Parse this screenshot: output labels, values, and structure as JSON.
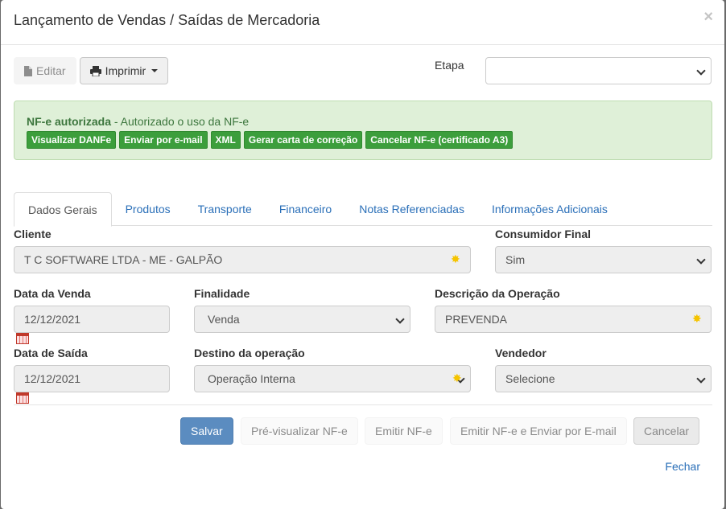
{
  "header": {
    "title": "Lançamento de Vendas / Saídas de Mercadoria",
    "close": "×"
  },
  "toolbar": {
    "edit_label": "Editar",
    "print_label": "Imprimir"
  },
  "etapa": {
    "label": "Etapa",
    "value": ""
  },
  "alert": {
    "status_bold": "NF-e autorizada",
    "status_text": " - Autorizado o uso da NF-e",
    "actions": [
      "Visualizar DANFe",
      "Enviar por e-mail",
      "XML",
      "Gerar carta de correção",
      "Cancelar NF-e (certificado A3)"
    ]
  },
  "tabs": [
    "Dados Gerais",
    "Produtos",
    "Transporte",
    "Financeiro",
    "Notas Referenciadas",
    "Informações Adicionais"
  ],
  "form": {
    "cliente": {
      "label": "Cliente",
      "value": "T C SOFTWARE LTDA - ME - GALPÃO"
    },
    "consumidor_final": {
      "label": "Consumidor Final",
      "value": "Sim"
    },
    "data_venda": {
      "label": "Data da Venda",
      "value": "12/12/2021"
    },
    "finalidade": {
      "label": "Finalidade",
      "value": "Venda"
    },
    "descricao_operacao": {
      "label": "Descrição da Operação",
      "value": "PREVENDA"
    },
    "data_saida": {
      "label": "Data de Saída",
      "value": "12/12/2021"
    },
    "destino_operacao": {
      "label": "Destino da operação",
      "value": "Operação Interna"
    },
    "vendedor": {
      "label": "Vendedor",
      "value": "Selecione"
    }
  },
  "footer": {
    "save": "Salvar",
    "preview": "Pré-visualizar NF-e",
    "emit": "Emitir NF-e",
    "emit_email": "Emitir NF-e e Enviar por E-mail",
    "cancel": "Cancelar",
    "close": "Fechar"
  },
  "colors": {
    "primary": "#5b8cc0",
    "success": "#3c9e3c",
    "link": "#2a6fb8",
    "required": "#f5c400"
  }
}
